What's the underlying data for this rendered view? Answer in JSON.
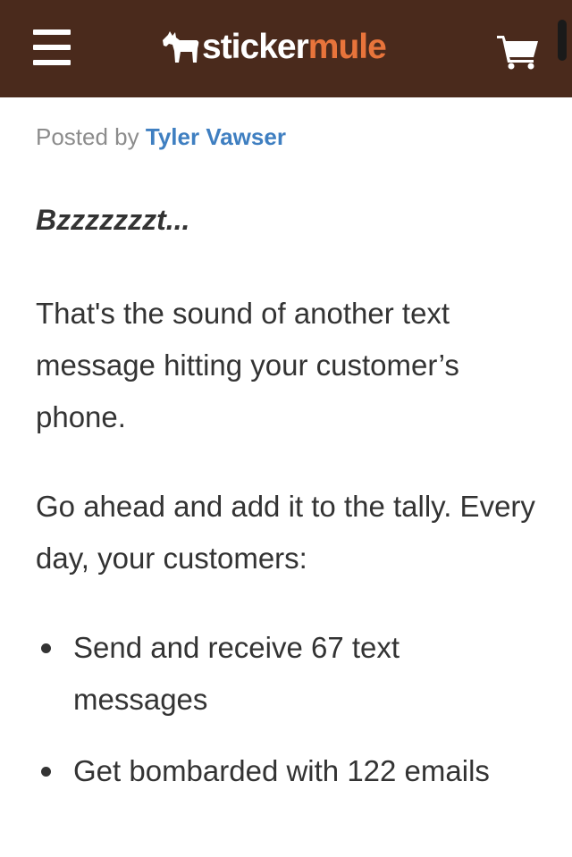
{
  "header": {
    "menu_icon": "hamburger-menu-icon",
    "brand_part1": "sticker",
    "brand_part2": "mule",
    "cart_icon": "shopping-cart-icon",
    "colors": {
      "bar": "#4a2a1c",
      "brand_accent": "#e8743b",
      "link": "#3f7fc1"
    }
  },
  "article": {
    "posted_by_label": "Posted by",
    "author": "Tyler Vawser",
    "lead": "Bzzzzzzzt...",
    "paragraphs": [
      "That's the sound of another text message hitting your customer’s phone.",
      "Go ahead and add it to the tally. Every day, your customers:"
    ],
    "bullets": [
      "Send and receive 67 text messages",
      "Get bombarded with 122 emails"
    ]
  }
}
